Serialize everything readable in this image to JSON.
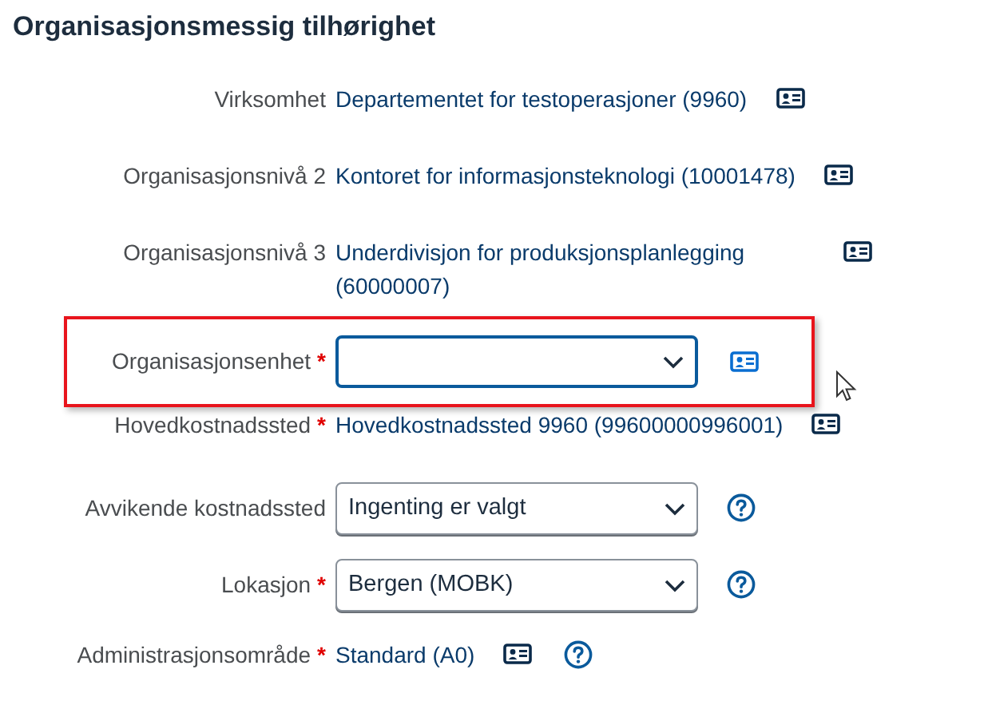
{
  "section": {
    "title": "Organisasjonsmessig tilhørighet"
  },
  "rows": [
    {
      "label": "Virksomhet",
      "kind": "display",
      "value": "Departementet for testoperasjoner (9960)",
      "details_button": true,
      "help_button": false,
      "focused": false,
      "highlighted": false
    },
    {
      "label": "Organisasjonsnivå 2",
      "kind": "display",
      "value": "Kontoret for informasjonsteknologi (10001478)",
      "details_button": true,
      "help_button": false,
      "focused": false,
      "highlighted": false
    },
    {
      "label": "Organisasjonsnivå 3",
      "kind": "display",
      "value": "Underdivisjon for produksjonsplanlegging (60000007)",
      "details_button": true,
      "help_button": false,
      "focused": false,
      "highlighted": false
    },
    {
      "label": "Organisasjonsenhet",
      "required_mark": "*",
      "kind": "select",
      "details_button": true,
      "help_button": false,
      "focused": true,
      "highlighted": true
    },
    {
      "label": "Hovedkostnadssted",
      "required_mark": "*",
      "kind": "display",
      "value": "Hovedkostnadssted 9960 (99600000996001)",
      "details_button": true,
      "help_button": false,
      "focused": false,
      "highlighted": false
    },
    {
      "label": "Avvikende kostnadssted",
      "kind": "select",
      "value": "Ingenting er valgt",
      "details_button": false,
      "help_button": true,
      "focused": false,
      "highlighted": false
    },
    {
      "label": "Lokasjon",
      "required_mark": "*",
      "kind": "select",
      "value": "Bergen (MOBK)",
      "details_button": false,
      "help_button": true,
      "focused": false,
      "highlighted": false
    },
    {
      "label": "Administrasjonsområde",
      "required_mark": "*",
      "kind": "display",
      "value": "Standard (A0)",
      "details_button": true,
      "help_button": true,
      "focused": false,
      "highlighted": false
    }
  ]
}
